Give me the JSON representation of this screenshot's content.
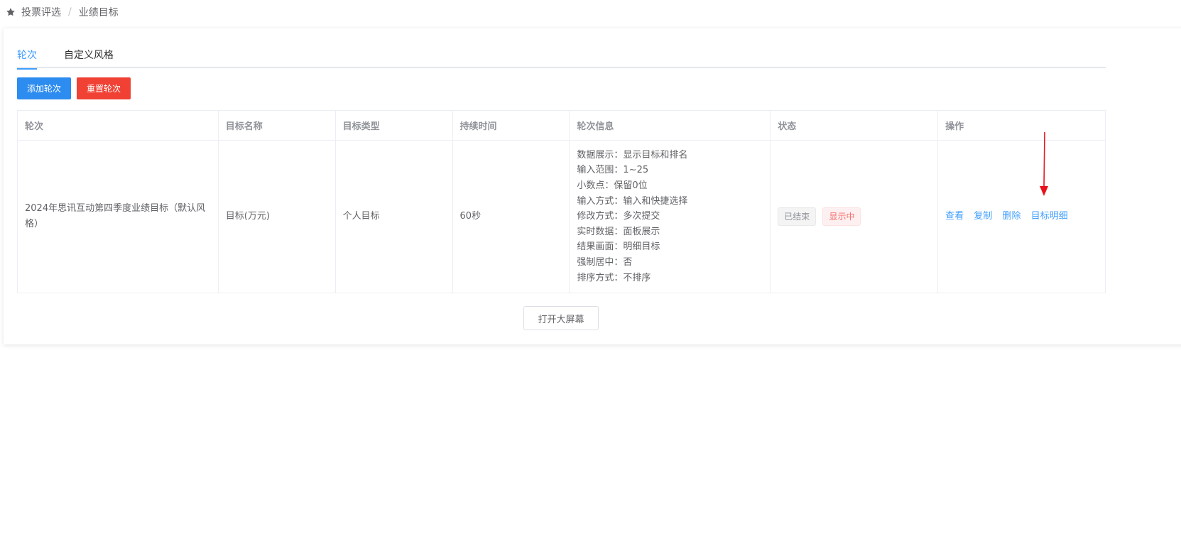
{
  "breadcrumb": {
    "icon": "star-icon",
    "items": [
      "投票评选",
      "业绩目标"
    ]
  },
  "tabs": [
    {
      "label": "轮次",
      "active": true
    },
    {
      "label": "自定义风格",
      "active": false
    }
  ],
  "toolbar": {
    "add_label": "添加轮次",
    "reset_label": "重置轮次"
  },
  "table": {
    "headers": [
      "轮次",
      "目标名称",
      "目标类型",
      "持续时间",
      "轮次信息",
      "状态",
      "操作"
    ],
    "rows": [
      {
        "round": "2024年思讯互动第四季度业绩目标（默认风格）",
        "target_name": "目标(万元)",
        "target_type": "个人目标",
        "duration": "60秒",
        "info": [
          "数据展示：显示目标和排名",
          "输入范围：1~25",
          "小数点：保留0位",
          "输入方式：输入和快捷选择",
          "修改方式：多次提交",
          "实时数据：面板展示",
          "结果画面：明细目标",
          "强制居中：否",
          "排序方式：不排序"
        ],
        "status_tags": [
          "已结束",
          "显示中"
        ],
        "actions": [
          "查看",
          "复制",
          "删除",
          "目标明细"
        ]
      }
    ]
  },
  "open_big_screen_label": "打开大屏幕",
  "colors": {
    "primary": "#2d8cf0",
    "danger": "#f04134",
    "link": "#409eff",
    "annotation_arrow": "#e8121b"
  }
}
